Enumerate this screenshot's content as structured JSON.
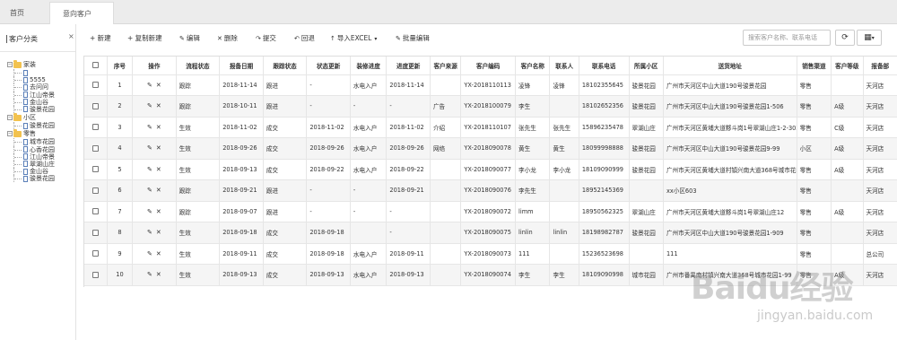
{
  "tabs": [
    {
      "label": "首页"
    },
    {
      "label": "意向客户"
    }
  ],
  "tab_close": "×",
  "sidebar": {
    "title": "客户分类",
    "tree": [
      {
        "label": "家装",
        "expander": "−",
        "children": [
          "",
          "5555",
          "去问问",
          "江山帝景",
          "金山谷",
          "骏景花园"
        ]
      },
      {
        "label": "小区",
        "expander": "−",
        "children": [
          "骏景花园"
        ]
      },
      {
        "label": "零售",
        "expander": "−",
        "children": [
          "城市花园",
          "心香花园",
          "江山帝景",
          "翠湖山庄",
          "金山谷",
          "骏景花园"
        ]
      }
    ]
  },
  "toolbar": {
    "new": "+ 新建",
    "copy_new": "+ 复制新建",
    "edit": "编辑",
    "delete": "删除",
    "submit": "提交",
    "rollback": "回退",
    "import_excel": "导入EXCEL",
    "batch_edit": "批量编辑"
  },
  "search": {
    "placeholder": "搜索客户名称、联系电话"
  },
  "table": {
    "columns": [
      "序号",
      "操作",
      "流程状态",
      "报备日期",
      "跟踪状态",
      "状态更新",
      "装修进度",
      "进度更新",
      "客户来源",
      "客户编码",
      "客户名称",
      "联系人",
      "联系电话",
      "所属小区",
      "送货地址",
      "销售渠道",
      "客户等级",
      "报备部"
    ],
    "rows": [
      [
        "1",
        "跟踪",
        "2018-11-14",
        "跟进",
        "-",
        "水电入户",
        "2018-11-14",
        "",
        "YX-2018110113",
        "凌锋",
        "凌锋",
        "18102355645",
        "骏景花园",
        "广州市天河区中山大道190号骏景花园",
        "零售",
        "",
        "天河店"
      ],
      [
        "2",
        "跟踪",
        "2018-10-11",
        "跟进",
        "-",
        "-",
        "-",
        "广告",
        "YX-2018100079",
        "李生",
        "",
        "18102652356",
        "骏景花园",
        "广州市天河区中山大道190号骏景花园1-506",
        "零售",
        "A级",
        "天河店"
      ],
      [
        "3",
        "生效",
        "2018-11-02",
        "成交",
        "2018-11-02",
        "水电入户",
        "2018-11-02",
        "介绍",
        "YX-2018110107",
        "张先生",
        "张先生",
        "15896235478",
        "翠湖山庄",
        "广州市天河区黄埔大道黟斗岗1号翠湖山庄1-2-302",
        "零售",
        "C级",
        "天河店"
      ],
      [
        "4",
        "生效",
        "2018-09-26",
        "成交",
        "2018-09-26",
        "水电入户",
        "2018-09-26",
        "网络",
        "YX-2018090078",
        "黄生",
        "黄生",
        "18099998888",
        "骏景花园",
        "广州市天河区中山大道190号骏景花园9-99",
        "小区",
        "A级",
        "天河店"
      ],
      [
        "5",
        "生效",
        "2018-09-13",
        "成交",
        "2018-09-22",
        "水电入户",
        "2018-09-22",
        "",
        "YX-2018090077",
        "李小龙",
        "李小龙",
        "18109090999",
        "骏景花园",
        "广州市天河区黄埔大道村镇兴南大道368号城市花园1-666",
        "零售",
        "A级",
        "天河店"
      ],
      [
        "6",
        "跟踪",
        "2018-09-21",
        "跟进",
        "-",
        "-",
        "2018-09-21",
        "",
        "YX-2018090076",
        "李先生",
        "",
        "18952145369",
        "",
        "xx小区603",
        "零售",
        "",
        "天河店"
      ],
      [
        "7",
        "跟踪",
        "2018-09-07",
        "跟进",
        "-",
        "-",
        "-",
        "",
        "YX-2018090072",
        "limm",
        "",
        "18950562325",
        "翠湖山庄",
        "广州市天河区黄埔大道黟斗岗1号翠湖山庄12",
        "零售",
        "A级",
        "天河店"
      ],
      [
        "8",
        "生效",
        "2018-09-18",
        "成交",
        "2018-09-18",
        "",
        "-",
        "",
        "YX-2018090075",
        "linlin",
        "linlin",
        "18198982787",
        "骏景花园",
        "广州市天河区中山大道190号骏景花园1-909",
        "零售",
        "",
        "天河店"
      ],
      [
        "9",
        "生效",
        "2018-09-11",
        "成交",
        "2018-09-18",
        "水电入户",
        "2018-09-11",
        "",
        "YX-2018090073",
        "111",
        "",
        "15236523698",
        "",
        "111",
        "零售",
        "",
        "总公司"
      ],
      [
        "10",
        "生效",
        "2018-09-13",
        "成交",
        "2018-09-13",
        "水电入户",
        "2018-09-13",
        "",
        "YX-2018090074",
        "李生",
        "李生",
        "18109090998",
        "城市花园",
        "广州市番禺南村镇兴南大道368号城市花园1-99",
        "零售",
        "A级",
        "天河店"
      ]
    ]
  },
  "watermark": {
    "logo": "Baidu经验",
    "url": "jingyan.baidu.com"
  },
  "colors": {
    "folder": "#f2c24f",
    "tabbar": "#ececec",
    "row_alt": "#f5f5f5"
  }
}
